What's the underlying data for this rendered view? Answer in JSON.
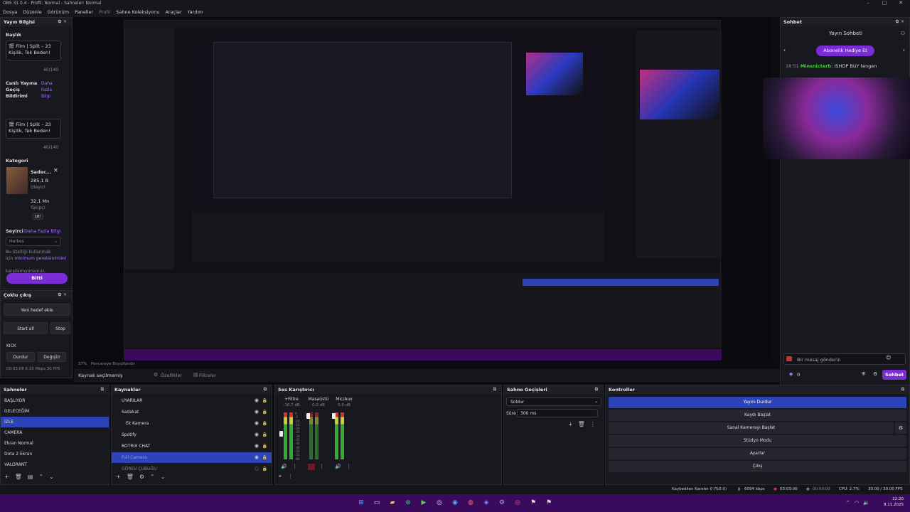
{
  "window": {
    "title": "OBS 31.0.4 - Profil: Normal - Sahneler: Normal",
    "min": "–",
    "max": "□",
    "close": "✕"
  },
  "menu": [
    "Dosya",
    "Düzenle",
    "Görünüm",
    "Paneller",
    "Profil",
    "Sahne Koleksiyonu",
    "Araçlar",
    "Yardım"
  ],
  "stream_info": {
    "dock_title": "Yayın Bilgisi",
    "title_label": "Başlık",
    "title_value": "🎬 Film | Split – 23 Kişilik, Tek Beden!",
    "title_count": "40/140",
    "transition_label": "Canlı Yayına Geçiş Bildirimi",
    "more_link": "Daha Fazla Bilgi",
    "notify_value": "🎬 Film | Split – 23 Kişilik, Tek Beden!",
    "notify_count": "40/140",
    "category_label": "Kategori",
    "category_name": "Sadec...",
    "viewers_value": "285,1 B",
    "viewers_label": "İzleyici",
    "followers_value": "32,1 Mn",
    "followers_label": "Takipçi",
    "tag": "18!",
    "audience_label": "Seyirci",
    "audience_link": "Daha Fazla Bilgi",
    "audience_select": "Herkes",
    "notice_line1": "Bu özelliği kullanmak",
    "notice_line2_pre": "için",
    "notice_link": "minimum gereksinimleri",
    "notice_line3": "karşılamıyorsunuz.",
    "done_button": "Bitti"
  },
  "multistream": {
    "dock_title": "Çoklu çıkış",
    "new_target": "Yeni hedef ekle",
    "start_all": "Start all",
    "stop": "Stop",
    "target_name": "KICK",
    "stop_btn": "Durdur",
    "change_btn": "Değiştir",
    "status": "03:03:08  6.10 Mbps  30 FPS"
  },
  "chat": {
    "dock_title": "Sohbet",
    "header": "Yayın Sohbeti",
    "gift_button": "Abonelik Hediye Et",
    "msg_time": "18:51",
    "msg_user": "Minsnicterb",
    "msg_text": ": ISHOP BUY tengen",
    "input_placeholder": "Bir mesaj gönderin",
    "points": "0",
    "send_button": "Sohbet"
  },
  "preview_status": {
    "zoom": "37%",
    "fit_label": "Pencereye Boyutlandır"
  },
  "source_toolbar": {
    "none_selected": "Kaynak seçilmemiş",
    "properties": "Özellikler",
    "filters": "Filtreler"
  },
  "scenes": {
    "dock_title": "Sahneler",
    "items": [
      "BAŞLIYOR",
      "GELECEĞİM",
      "İZLE",
      "CAMERA",
      "Ekran Normal",
      "Dota 2 Ekran",
      "VALORANT"
    ],
    "selected_index": 2
  },
  "sources": {
    "dock_title": "Kaynaklar",
    "items": [
      "UYARILAR",
      "Sadakat",
      "Ek Kamera",
      "Spotify",
      "BOTRIX CHAT",
      "Full Camera",
      "GÖREV ÇUBUĞU"
    ],
    "selected_index": 5
  },
  "mixer": {
    "dock_title": "Ses Karıştırıcı",
    "channels": [
      {
        "name": "+Filtre",
        "db": "-16.7 dB"
      },
      {
        "name": "Masaüstü",
        "db": "0.0 dB"
      },
      {
        "name": "Mic/Aux",
        "db": "0.0 dB"
      }
    ],
    "scale": [
      "0",
      "-5",
      "-10",
      "-15",
      "-20",
      "-25",
      "-30",
      "-35",
      "-40",
      "-45",
      "-50",
      "-55",
      "-60"
    ]
  },
  "transitions": {
    "dock_title": "Sahne Geçişleri",
    "type": "Soldur",
    "duration_label": "Süre",
    "duration_value": "300 ms"
  },
  "controls": {
    "dock_title": "Kontroller",
    "buttons": [
      "Yayını Durdur",
      "Kaydı Başlat",
      "Sanal Kamerayı Başlat",
      "Stüdyo Modu",
      "Ayarlar",
      "Çıkış"
    ]
  },
  "statusbar": {
    "dropped": "Kaybedilen Kareler 0 (%0.0)",
    "bitrate": "6094 kbps",
    "stream_time": "03:03:06",
    "rec_time": "00:00:00",
    "cpu": "CPU: 2.7%",
    "fps": "30.00 / 30.00 FPS"
  },
  "taskbar": {
    "time": "22:20",
    "date": "8.11.2025"
  },
  "colors": {
    "accent_blue": "#2b44b8",
    "twitch_purple": "#7a2cd6",
    "taskbar": "#3a0a5c"
  }
}
